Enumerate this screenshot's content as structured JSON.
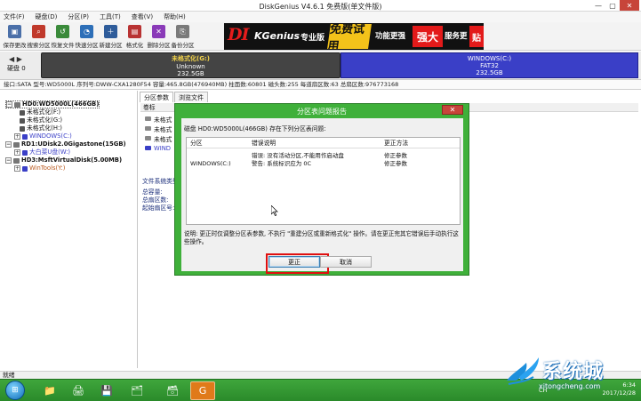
{
  "window": {
    "title": "DiskGenius V4.6.1 免费版(单文件版)"
  },
  "menu": [
    "文件(F)",
    "硬盘(D)",
    "分区(P)",
    "工具(T)",
    "查看(V)",
    "帮助(H)"
  ],
  "toolbar": [
    {
      "label": "保存更改",
      "icon": "save-icon",
      "color": "#4a6fa8"
    },
    {
      "label": "搜索分区",
      "icon": "search-partition-icon",
      "color": "#c0392b"
    },
    {
      "label": "恢复文件",
      "icon": "recover-file-icon",
      "color": "#3a8a3a"
    },
    {
      "label": "快速分区",
      "icon": "quick-partition-icon",
      "color": "#2d6fb8"
    },
    {
      "label": "新建分区",
      "icon": "new-partition-icon",
      "color": "#2e5c9a"
    },
    {
      "label": "格式化",
      "icon": "format-icon",
      "color": "#b83232"
    },
    {
      "label": "删除分区",
      "icon": "delete-partition-icon",
      "color": "#8a3ab8"
    },
    {
      "label": "备份分区",
      "icon": "backup-partition-icon",
      "color": "#7a7a7a"
    }
  ],
  "banner": {
    "logo": "DI",
    "logo_rest": "KGenius",
    "pro": "专业版",
    "b1": "免费试用",
    "b2": "功能更强",
    "b3": "强大",
    "b4": "服务更",
    "b5": "贴"
  },
  "diskbar": {
    "nav": "◀ ▶",
    "disk_label_line1": "硬盘 0",
    "partitions": [
      {
        "name": "未格式化(G:)",
        "fs": "Unknown",
        "size": "232.5GB"
      },
      {
        "name": "WINDOWS(C:)",
        "fs": "FAT32",
        "size": "232.5GB"
      }
    ]
  },
  "infobar": "接口:SATA  型号:WD5000L  序列号:DWW-CXA1280F54  容量:465.8GB(476940MB)  柱面数:60801  磁头数:255  每道扇区数:63  总扇区数:976773168",
  "tree": [
    {
      "text": "HD0:WD5000L(466GB)",
      "level": 0,
      "type": "disk",
      "bold": true,
      "sel": true
    },
    {
      "text": "未格式化(F:)",
      "level": 1,
      "type": "part",
      "color": "#555"
    },
    {
      "text": "未格式化(G:)",
      "level": 1,
      "type": "part",
      "color": "#555"
    },
    {
      "text": "未格式化(H:)",
      "level": 1,
      "type": "part",
      "color": "#555"
    },
    {
      "text": "WINDOWS(C:)",
      "level": 1,
      "type": "part",
      "color": "#3a3fc7"
    },
    {
      "text": "RD1:UDisk2.0Gigastone(15GB)",
      "level": 0,
      "type": "disk",
      "bold": true
    },
    {
      "text": "大白菜U盘(W:)",
      "level": 1,
      "type": "part",
      "color": "#3a3fc7"
    },
    {
      "text": "HD3:MsftVirtualDisk(5.00MB)",
      "level": 0,
      "type": "disk",
      "bold": true
    },
    {
      "text": "WinTools(Y:)",
      "level": 1,
      "type": "part",
      "color": "#3a3fc7"
    }
  ],
  "tabs": [
    "分区参数",
    "浏览文件"
  ],
  "table": {
    "header": "卷标",
    "rows": [
      "未格式",
      "未格式",
      "未格式",
      "WIND"
    ]
  },
  "fsinfo": {
    "title": "文件系统类型:",
    "lines": [
      "总容量:",
      "总扇区数:",
      "起始扇区号:"
    ]
  },
  "dialog": {
    "title": "分区表问题报告",
    "close": "✕",
    "intro": "磁盘 HD0:WD5000L(466GB) 存在下列分区表问题:",
    "columns": [
      "分区",
      "错误说明",
      "更正方法"
    ],
    "rows": [
      {
        "partition": "",
        "desc": "错误: 没有活动分区,不能用作启动盘",
        "fix": "修正参数"
      },
      {
        "partition": "WINDOWS(C:)",
        "desc": "警告: 系统标识应为 0C",
        "fix": "修正参数"
      }
    ],
    "note": "说明: 更正时仅调整分区表参数, 不执行 \"重建分区或重新格式化\" 操作。请在更正完其它错误后手动执行这些操作。",
    "ok": "更正",
    "cancel": "取消"
  },
  "status": "就绪",
  "taskbar": {
    "start": "⊞",
    "apps": [
      "📁",
      "🖨",
      "💾",
      "🗂",
      "🗃",
      "G"
    ],
    "ch": "CH",
    "time": "6:34",
    "date": "2017/12/28"
  },
  "watermark": {
    "text": "系统城",
    "url": "xitongcheng.com"
  }
}
